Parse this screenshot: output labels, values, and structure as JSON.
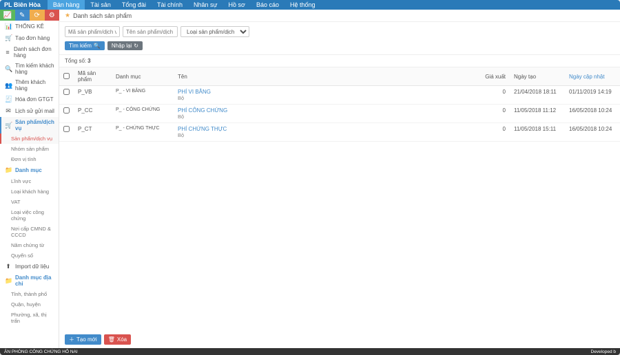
{
  "brand": "PL Biên Hòa",
  "topnav": [
    {
      "label": "Bán hàng",
      "active": true
    },
    {
      "label": "Tài sản",
      "active": false
    },
    {
      "label": "Tổng đài",
      "active": false
    },
    {
      "label": "Tài chính",
      "active": false
    },
    {
      "label": "Nhân sự",
      "active": false
    },
    {
      "label": "Hồ sơ",
      "active": false
    },
    {
      "label": "Báo cáo",
      "active": false
    },
    {
      "label": "Hệ thống",
      "active": false
    }
  ],
  "sidebar": {
    "stats": "THỐNG KÊ",
    "items1": [
      {
        "icon": "🛒",
        "label": "Tạo đơn hàng"
      },
      {
        "icon": "≡",
        "label": "Danh sách đơn hàng"
      },
      {
        "icon": "🔍",
        "label": "Tìm kiếm khách hàng"
      },
      {
        "icon": "👥",
        "label": "Thêm khách hàng"
      },
      {
        "icon": "🧾",
        "label": "Hóa đơn GTGT"
      },
      {
        "icon": "✉",
        "label": "Lịch sử gửi mail"
      }
    ],
    "productsHeader": "Sản phẩm/dịch vụ",
    "productsSubs": [
      {
        "label": "Sản phẩm/dịch vụ",
        "active": true
      },
      {
        "label": "Nhóm sản phẩm",
        "active": false
      },
      {
        "label": "Đơn vị tính",
        "active": false
      }
    ],
    "catalogHeader": "Danh mục",
    "catalogSubs": [
      "Lĩnh vực",
      "Loại khách hàng",
      "VAT",
      "Loại việc công chứng",
      "Nơi cấp CMND & CCCD",
      "Năm chứng từ",
      "Quyển số"
    ],
    "importLabel": "Import dữ liệu",
    "geoHeader": "Danh mục địa chỉ",
    "geoSubs": [
      "Tỉnh, thành phố",
      "Quận, huyện",
      "Phường, xã, thị trấn"
    ]
  },
  "page": {
    "title": "Danh sách sản phẩm",
    "filters": {
      "codePh": "Mã sản phẩm/dịch vụ",
      "namePh": "Tên sản phẩm/dịch vụ",
      "typePh": "Loại sản phẩm/dịch vụ"
    },
    "searchBtn": "Tìm kiếm",
    "resetBtn": "Nhập lại",
    "totalLabel": "Tổng số:",
    "totalValue": "3",
    "cols": {
      "code": "Mã sản phẩm",
      "cat": "Danh mục",
      "name": "Tên",
      "price": "Giá xuất",
      "created": "Ngày tạo",
      "updated": "Ngày cập nhật"
    },
    "rows": [
      {
        "code": "P_VB",
        "cat": "P_ - VI BẰNG",
        "name": "PHÍ VI BẰNG",
        "unit": "Bộ",
        "price": "0",
        "created": "21/04/2018 18:11",
        "updated": "01/11/2019 14:19"
      },
      {
        "code": "P_CC",
        "cat": "P_ - CÔNG CHỨNG",
        "name": "PHÍ CÔNG CHỨNG",
        "unit": "Bộ",
        "price": "0",
        "created": "11/05/2018 11:12",
        "updated": "16/05/2018 10:24"
      },
      {
        "code": "P_CT",
        "cat": "P_ - CHỨNG THỰC",
        "name": "PHÍ CHỨNG THỰC",
        "unit": "Bộ",
        "price": "0",
        "created": "11/05/2018 15:11",
        "updated": "16/05/2018 10:24"
      }
    ],
    "addBtn": "Tạo mới",
    "delBtn": "Xóa"
  },
  "footer": {
    "left": "ĂN PHÒNG CÔNG CHỨNG HỐ NAI",
    "right": "Developed b"
  }
}
